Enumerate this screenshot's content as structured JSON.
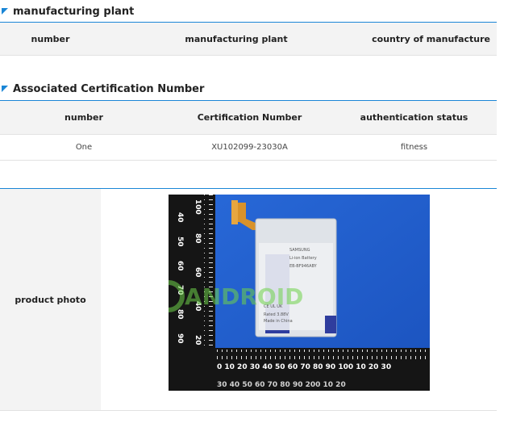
{
  "manufacturing_section": {
    "title": "manufacturing plant",
    "headers": [
      "number",
      "manufacturing plant",
      "country of manufacture"
    ]
  },
  "certification_section": {
    "title": "Associated Certification Number",
    "headers": [
      "number",
      "Certification Number",
      "authentication status"
    ],
    "rows": [
      {
        "number": "One",
        "certification_number": "XU102099-23030A",
        "status": "fitness"
      }
    ]
  },
  "product": {
    "label": "product photo",
    "photo": {
      "watermark": "ANDROID",
      "battery_brand": "SAMSUNG",
      "colors": {
        "background": "#1f5fd1",
        "ruler": "#151515",
        "battery": "#dfe3e8",
        "flex_cable": "#d8922a"
      }
    }
  },
  "colors": {
    "accent": "#1a86d6",
    "header_bg": "#f3f3f3"
  }
}
